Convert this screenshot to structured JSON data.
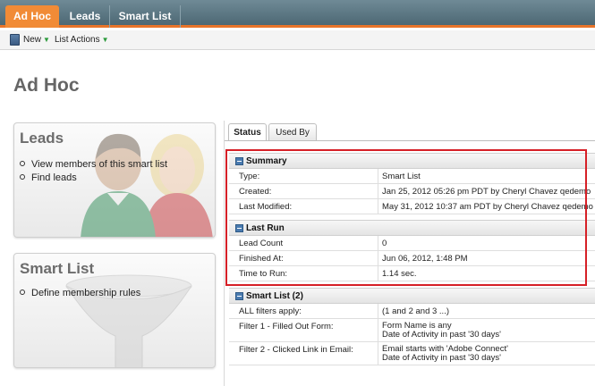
{
  "nav": {
    "tabs": [
      {
        "label": "Ad Hoc",
        "active": true
      },
      {
        "label": "Leads",
        "active": false
      },
      {
        "label": "Smart List",
        "active": false
      }
    ]
  },
  "toolbar": {
    "new_label": "New",
    "list_actions_label": "List Actions"
  },
  "page": {
    "title": "Ad Hoc"
  },
  "cards": {
    "leads": {
      "title": "Leads",
      "links": [
        "View members of this smart list",
        "Find leads"
      ]
    },
    "smart_list": {
      "title": "Smart List",
      "links": [
        "Define membership rules"
      ]
    }
  },
  "detail_tabs": [
    {
      "label": "Status",
      "active": true
    },
    {
      "label": "Used By",
      "active": false
    }
  ],
  "summary": {
    "title": "Summary",
    "rows": [
      {
        "key": "Type:",
        "value": "Smart List"
      },
      {
        "key": "Created:",
        "value": "Jan 25, 2012 05:26 pm PDT by Cheryl Chavez qedemo"
      },
      {
        "key": "Last Modified:",
        "value": "May 31, 2012 10:37 am PDT by Cheryl Chavez qedemo"
      }
    ]
  },
  "last_run": {
    "title": "Last Run",
    "rows": [
      {
        "key": "Lead Count",
        "value": "0"
      },
      {
        "key": "Finished At:",
        "value": "Jun 06, 2012, 1:48 PM"
      },
      {
        "key": "Time to Run:",
        "value": "1.14 sec."
      }
    ]
  },
  "smart_list_section": {
    "title": "Smart List (2)",
    "rows": [
      {
        "key": "ALL filters apply:",
        "value": "(1 and 2 and 3 ...)"
      },
      {
        "key": "Filter 1 - Filled Out Form:",
        "value": "Form Name is any",
        "value2": "Date of Activity in past '30 days'"
      },
      {
        "key": "Filter 2 - Clicked Link in Email:",
        "value": "Email starts with 'Adobe Connect'",
        "value2": "Date of Activity in past '30 days'"
      }
    ]
  },
  "colors": {
    "accent_orange": "#f18b36",
    "nav_bg": "#5a7581",
    "highlight_red": "#d62027"
  }
}
